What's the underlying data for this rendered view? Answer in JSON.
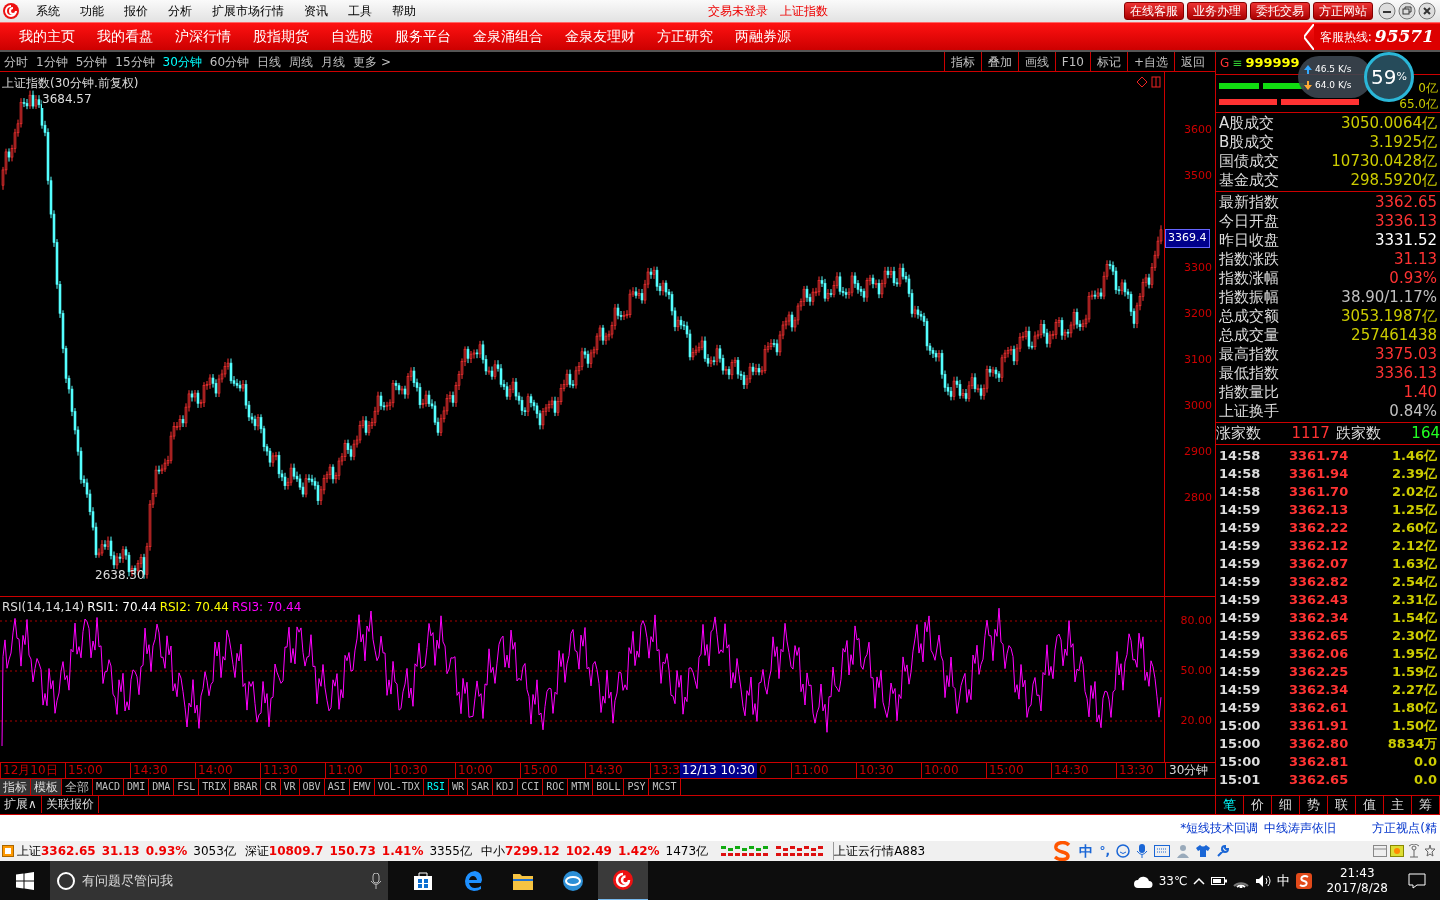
{
  "app": {
    "menu": [
      "系统",
      "功能",
      "报价",
      "分析",
      "扩展市场行情",
      "资讯",
      "工具",
      "帮助"
    ],
    "login_status": "交易未登录",
    "current_security": "上证指数",
    "top_buttons": [
      "在线客服",
      "业务办理",
      "委托交易",
      "方正网站"
    ]
  },
  "nav": {
    "items": [
      "我的主页",
      "我的看盘",
      "沪深行情",
      "股指期货",
      "自选股",
      "服务平台",
      "金泉涌组合",
      "金泉友理财",
      "方正研究",
      "两融券源"
    ],
    "hotline_label": "客服热线:",
    "hotline": "95571"
  },
  "periods": [
    {
      "label": "分时",
      "selected": false
    },
    {
      "label": "1分钟",
      "selected": false
    },
    {
      "label": "5分钟",
      "selected": false
    },
    {
      "label": "15分钟",
      "selected": false
    },
    {
      "label": "30分钟",
      "selected": true
    },
    {
      "label": "60分钟",
      "selected": false
    },
    {
      "label": "日线",
      "selected": false
    },
    {
      "label": "周线",
      "selected": false
    },
    {
      "label": "月线",
      "selected": false
    },
    {
      "label": "更多 >",
      "selected": false
    }
  ],
  "chart_tools": [
    "指标",
    "叠加",
    "画线",
    "F10",
    "标记",
    "+自选",
    "返回"
  ],
  "chart": {
    "title": "上证指数(30分钟.前复权)",
    "high_label": "3684.57",
    "low_label": "2638.30",
    "price_tag": "3369.4",
    "yaxis": [
      "3600",
      "3500",
      "3300",
      "3200",
      "3100",
      "3000",
      "2900",
      "2800"
    ]
  },
  "rsi": {
    "title": "RSI(14,14,14)",
    "lines": [
      {
        "label": "RSI1: 70.44",
        "color": "#ffffff"
      },
      {
        "label": "RSI2: 70.44",
        "color": "#ffff00"
      },
      {
        "label": "RSI3: 70.44",
        "color": "#ff00ff"
      }
    ],
    "yaxis": [
      "80.00",
      "50.00",
      "20.00"
    ]
  },
  "time_axis": {
    "labels_before": [
      "12月10日",
      "15:00",
      "14:30",
      "14:00",
      "11:30",
      "11:00",
      "10:30",
      "10:00",
      "15:00",
      "14:30",
      "13:3"
    ],
    "cursor_label": "12/13 10:30",
    "labels_after": [
      "0",
      "11:00",
      "10:30",
      "10:00",
      "15:00",
      "14:30",
      "13:30"
    ],
    "period": "30分钟"
  },
  "indicator_buttons": [
    "指标",
    "模板"
  ],
  "indicator_tabs": [
    {
      "label": "全部",
      "selected": false
    },
    {
      "label": "MACD",
      "selected": false
    },
    {
      "label": "DMI",
      "selected": false
    },
    {
      "label": "DMA",
      "selected": false
    },
    {
      "label": "FSL",
      "selected": false
    },
    {
      "label": "TRIX",
      "selected": false
    },
    {
      "label": "BRAR",
      "selected": false
    },
    {
      "label": "CR",
      "selected": false
    },
    {
      "label": "VR",
      "selected": false
    },
    {
      "label": "OBV",
      "selected": false
    },
    {
      "label": "ASI",
      "selected": false
    },
    {
      "label": "EMV",
      "selected": false
    },
    {
      "label": "VOL-TDX",
      "selected": false
    },
    {
      "label": "RSI",
      "selected": true
    },
    {
      "label": "WR",
      "selected": false
    },
    {
      "label": "SAR",
      "selected": false
    },
    {
      "label": "KDJ",
      "selected": false
    },
    {
      "label": "CCI",
      "selected": false
    },
    {
      "label": "ROC",
      "selected": false
    },
    {
      "label": "MTM",
      "selected": false
    },
    {
      "label": "BOLL",
      "selected": false
    },
    {
      "label": "PSY",
      "selected": false
    },
    {
      "label": "MCST",
      "selected": false
    }
  ],
  "bottom_tabs": [
    "扩展∧",
    "关联报价"
  ],
  "quote": {
    "marker": "G",
    "menu": "≡",
    "code": "999999",
    "flow": {
      "up": "46.5",
      "up_unit": "K/s",
      "down": "64.0",
      "down_unit": "K/s",
      "percent": "59",
      "percent_sign": "%"
    },
    "bar_readings": [
      "0亿",
      "65.0亿"
    ],
    "turnover": [
      {
        "label": "A股成交",
        "value": "3050.0064亿"
      },
      {
        "label": "B股成交",
        "value": "3.1925亿"
      },
      {
        "label": "国债成交",
        "value": "10730.0428亿"
      },
      {
        "label": "基金成交",
        "value": "298.5920亿"
      }
    ],
    "stats": [
      {
        "label": "最新指数",
        "value": "3362.65",
        "color": "#ff3333"
      },
      {
        "label": "今日开盘",
        "value": "3336.13",
        "color": "#ff3333"
      },
      {
        "label": "昨日收盘",
        "value": "3331.52",
        "color": "#ffffff"
      },
      {
        "label": "指数涨跌",
        "value": "31.13",
        "color": "#ff3333"
      },
      {
        "label": "指数涨幅",
        "value": "0.93%",
        "color": "#ff3333"
      },
      {
        "label": "指数振幅",
        "value": "38.90/1.17%",
        "color": "#c0c0c0"
      },
      {
        "label": "总成交额",
        "value": "3053.1987亿",
        "color": "#cccc00"
      },
      {
        "label": "总成交量",
        "value": "257461438",
        "color": "#cccc00"
      },
      {
        "label": "最高指数",
        "value": "3375.03",
        "color": "#ff3333"
      },
      {
        "label": "最低指数",
        "value": "3336.13",
        "color": "#ff3333"
      },
      {
        "label": "指数量比",
        "value": "1.40",
        "color": "#ff3333"
      },
      {
        "label": "上证换手",
        "value": "0.84%",
        "color": "#c0c0c0"
      }
    ],
    "breadth": {
      "up_label": "涨家数",
      "up": "1117",
      "down_label": "跌家数",
      "down": "164"
    },
    "ticks": [
      {
        "time": "14:58",
        "price": "3361.74",
        "volume": "1.46亿"
      },
      {
        "time": "14:58",
        "price": "3361.94",
        "volume": "2.39亿"
      },
      {
        "time": "14:58",
        "price": "3361.70",
        "volume": "2.02亿"
      },
      {
        "time": "14:59",
        "price": "3362.13",
        "volume": "1.25亿"
      },
      {
        "time": "14:59",
        "price": "3362.22",
        "volume": "2.60亿"
      },
      {
        "time": "14:59",
        "price": "3362.12",
        "volume": "2.12亿"
      },
      {
        "time": "14:59",
        "price": "3362.07",
        "volume": "1.63亿"
      },
      {
        "time": "14:59",
        "price": "3362.82",
        "volume": "2.54亿"
      },
      {
        "time": "14:59",
        "price": "3362.43",
        "volume": "2.31亿"
      },
      {
        "time": "14:59",
        "price": "3362.34",
        "volume": "1.54亿"
      },
      {
        "time": "14:59",
        "price": "3362.65",
        "volume": "2.30亿"
      },
      {
        "time": "14:59",
        "price": "3362.06",
        "volume": "1.95亿"
      },
      {
        "time": "14:59",
        "price": "3362.25",
        "volume": "1.59亿"
      },
      {
        "time": "14:59",
        "price": "3362.34",
        "volume": "2.27亿"
      },
      {
        "time": "14:59",
        "price": "3362.61",
        "volume": "1.80亿"
      },
      {
        "time": "15:00",
        "price": "3361.91",
        "volume": "1.50亿"
      },
      {
        "time": "15:00",
        "price": "3362.80",
        "volume": "8834万"
      },
      {
        "time": "15:00",
        "price": "3362.81",
        "volume": "0.0"
      },
      {
        "time": "15:01",
        "price": "3362.65",
        "volume": "0.0"
      }
    ],
    "tabs": [
      {
        "label": "笔",
        "selected": true
      },
      {
        "label": "价",
        "selected": false
      },
      {
        "label": "细",
        "selected": false
      },
      {
        "label": "势",
        "selected": false
      },
      {
        "label": "联",
        "selected": false
      },
      {
        "label": "值",
        "selected": false
      },
      {
        "label": "主",
        "selected": false
      },
      {
        "label": "筹",
        "selected": false
      }
    ]
  },
  "news": [
    "*短线技术回调",
    "中线涛声依旧",
    "方正视点(精"
  ],
  "status": {
    "indices": [
      {
        "name": "上证",
        "value": "3362.65",
        "change": "31.13",
        "pct": "0.93%",
        "amount": "3053亿"
      },
      {
        "name": "深证",
        "value": "10809.7",
        "change": "150.73",
        "pct": "1.41%",
        "amount": "3355亿"
      },
      {
        "name": "中小",
        "value": "7299.12",
        "change": "102.49",
        "pct": "1.42%",
        "amount": "1473亿"
      }
    ],
    "cloud": "上证云行情A883"
  },
  "ime": {
    "mode": "中",
    "punct": "°,"
  },
  "taskbar": {
    "search_placeholder": "有问题尽管问我",
    "weather": "33℃",
    "ime": "中",
    "time": "21:43",
    "date": "2017/8/28"
  }
}
